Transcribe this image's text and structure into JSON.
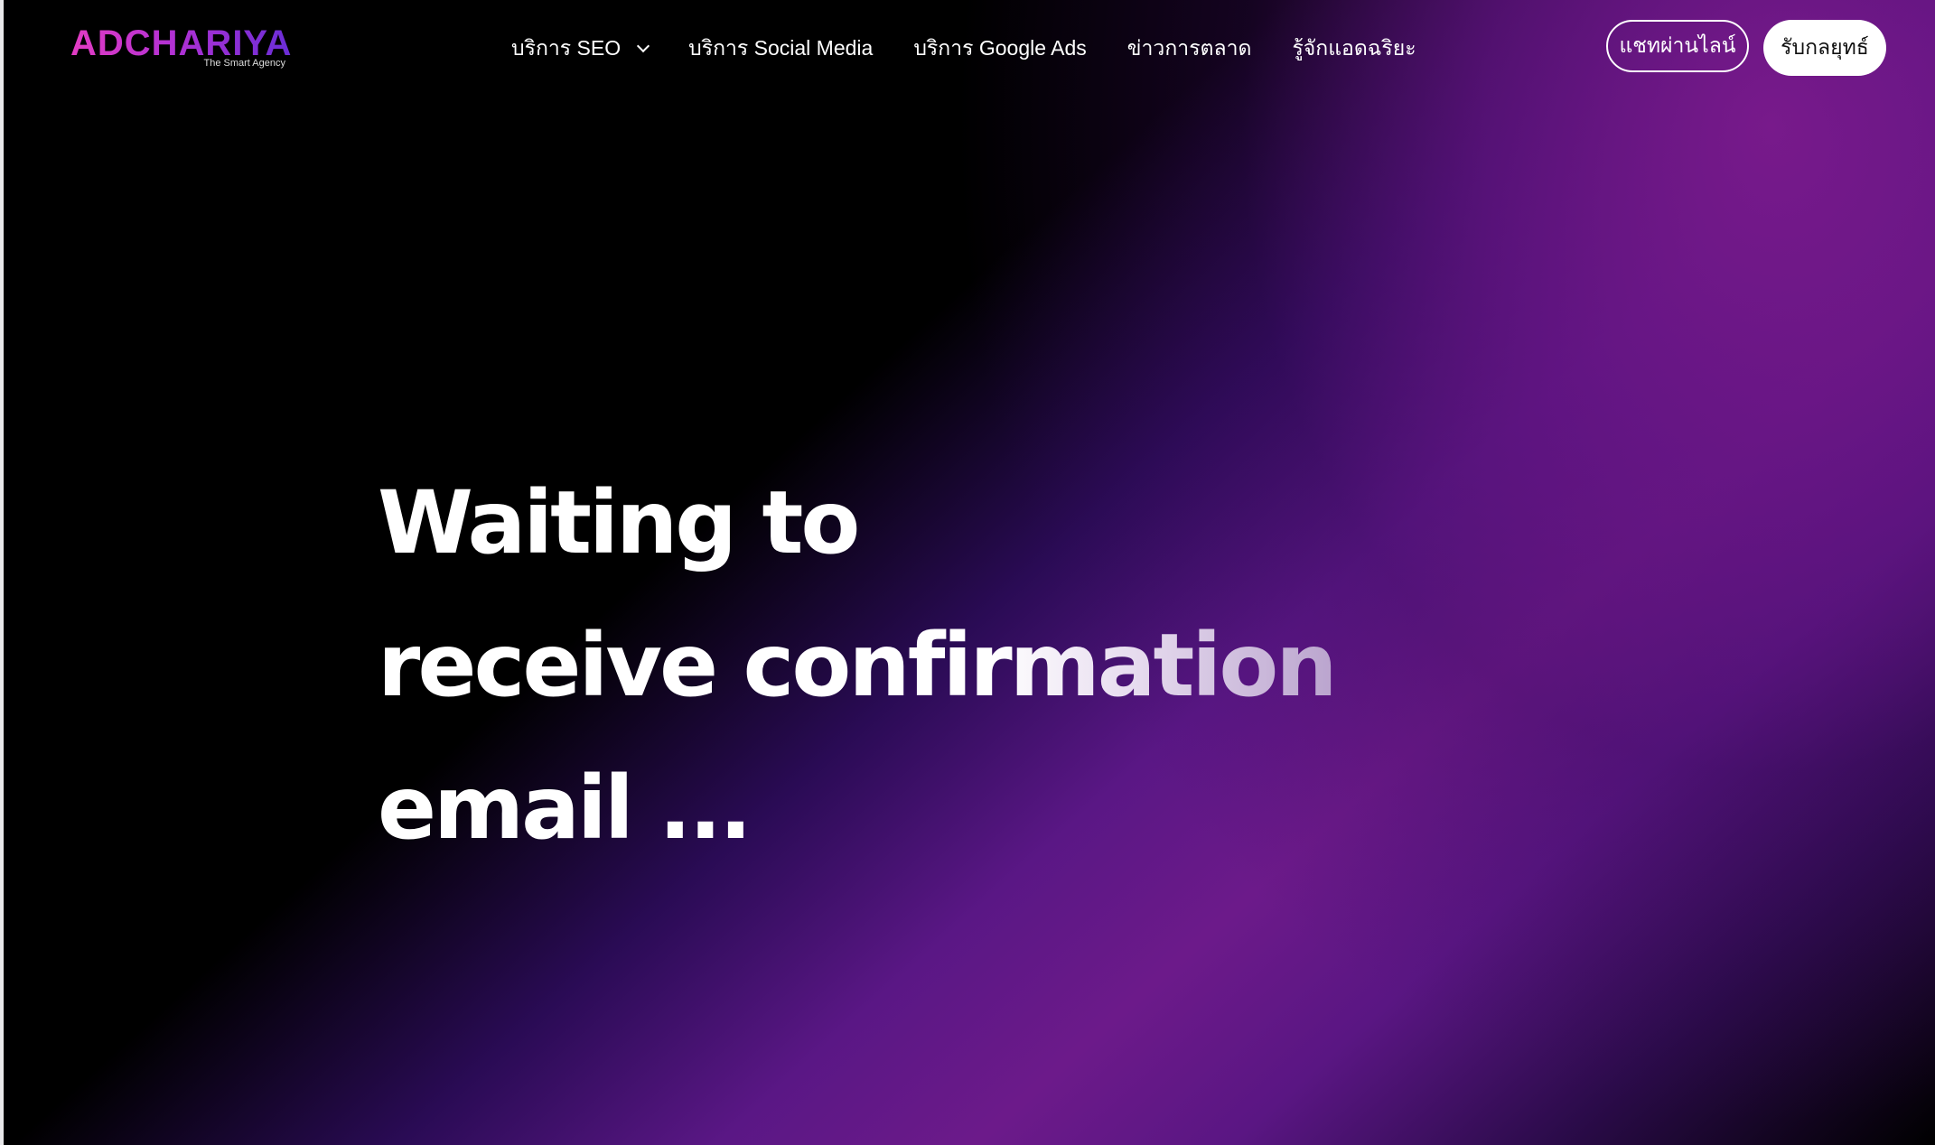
{
  "header": {
    "logo": {
      "wordmark": "ADCHARIYA",
      "tagline": "The Smart Agency"
    },
    "nav": [
      {
        "label": "บริการ SEO",
        "has_dropdown": true,
        "icon": "chevron-down-icon"
      },
      {
        "label": "บริการ Social Media",
        "has_dropdown": false
      },
      {
        "label": "บริการ Google Ads",
        "has_dropdown": false
      },
      {
        "label": "ข่าวการตลาด",
        "has_dropdown": false
      },
      {
        "label": "รู้จักแอดฉริยะ",
        "has_dropdown": false
      }
    ],
    "actions": {
      "line_chat_label": "แชทผ่านไลน์",
      "strategy_label": "รับกลยุทธ์"
    }
  },
  "hero": {
    "lines": [
      "Waiting to",
      "receive confirmation",
      "email ..."
    ]
  },
  "colors": {
    "background": "#000000",
    "gradient_purple": "#6c1a8a",
    "logo_pink": "#e33cc3",
    "logo_violet": "#6a2dd6",
    "text": "#ffffff"
  }
}
